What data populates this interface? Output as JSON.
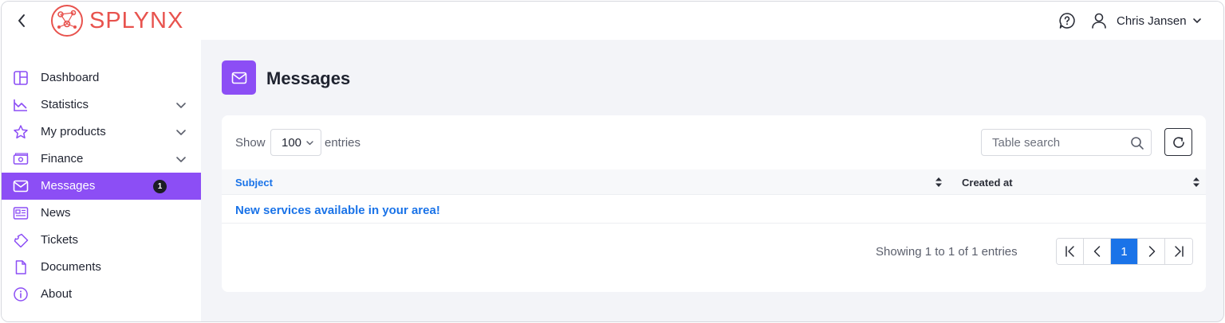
{
  "brand": {
    "logo_text": "SPLYNX",
    "color": "#e8534e"
  },
  "header": {
    "user_name": "Chris Jansen"
  },
  "sidebar": {
    "items": [
      {
        "label": "Dashboard",
        "icon": "dashboard-icon"
      },
      {
        "label": "Statistics",
        "icon": "chart-icon",
        "expandable": true
      },
      {
        "label": "My products",
        "icon": "star-icon",
        "expandable": true
      },
      {
        "label": "Finance",
        "icon": "money-icon",
        "expandable": true
      },
      {
        "label": "Messages",
        "icon": "envelope-icon",
        "active": true,
        "badge": "1"
      },
      {
        "label": "News",
        "icon": "newspaper-icon"
      },
      {
        "label": "Tickets",
        "icon": "ticket-icon"
      },
      {
        "label": "Documents",
        "icon": "document-icon"
      },
      {
        "label": "About",
        "icon": "info-icon"
      }
    ]
  },
  "page": {
    "title": "Messages",
    "icon": "envelope-icon"
  },
  "table_controls": {
    "show_label": "Show",
    "length_value": "100",
    "entries_label": "entries",
    "search_placeholder": "Table search"
  },
  "table": {
    "columns": [
      "Subject",
      "Created at"
    ],
    "rows": [
      {
        "subject": "New services available in your area!",
        "created_at": ""
      }
    ]
  },
  "pagination": {
    "info": "Showing 1 to 1 of 1 entries",
    "current_page": "1"
  },
  "colors": {
    "accent": "#8c4ef5",
    "link": "#1a73e8"
  }
}
